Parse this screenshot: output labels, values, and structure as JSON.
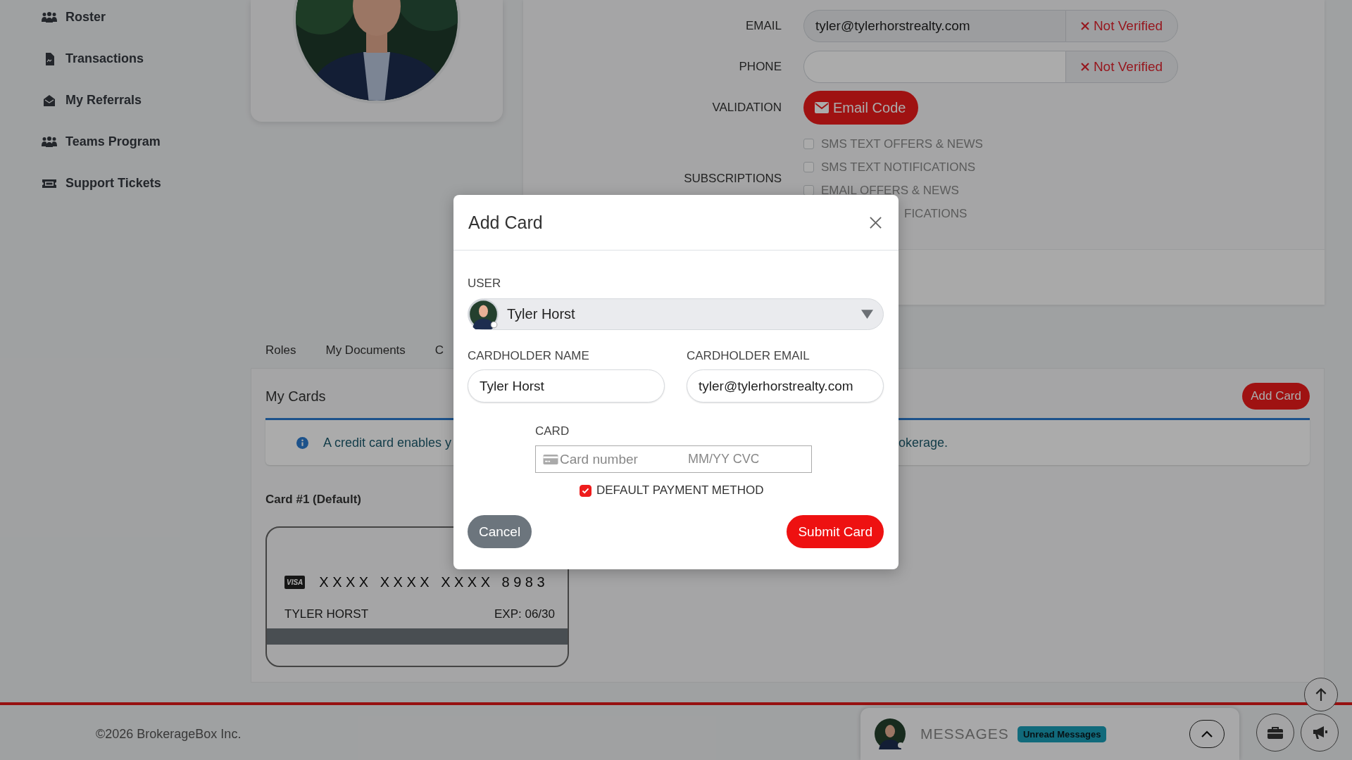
{
  "sidebar": {
    "items": [
      {
        "label": "Roster"
      },
      {
        "label": "Transactions"
      },
      {
        "label": "My Referrals"
      },
      {
        "label": "Teams Program"
      },
      {
        "label": "Support Tickets"
      }
    ]
  },
  "contact": {
    "rows": [
      {
        "label": "EMAIL",
        "value": "tyler@tylerhorstrealty.com",
        "status": "Not Verified",
        "readonly": true
      },
      {
        "label": "PHONE",
        "status": "Not Verified",
        "readonly": false
      }
    ]
  },
  "validation": {
    "label": "VALIDATION",
    "button": "Email Code"
  },
  "subscriptions": {
    "label": "SUBSCRIPTIONS",
    "options": [
      {
        "label": "SMS TEXT OFFERS & NEWS",
        "checked": false
      },
      {
        "label": "SMS TEXT NOTIFICATIONS",
        "checked": false
      },
      {
        "label": "EMAIL OFFERS & NEWS",
        "checked": false
      }
    ],
    "partial_option": "FICATIONS"
  },
  "tabs": [
    {
      "label": "Roles",
      "selected": false
    },
    {
      "label": "My Documents",
      "selected": false
    },
    {
      "label": "C",
      "selected": false
    }
  ],
  "cards_panel": {
    "title": "My Cards",
    "add_button": "Add Card",
    "info_start": "A credit card enables y",
    "info_end": "okerage.",
    "cards": [
      {
        "title": "Card #1 (Default)",
        "brand": "VISA",
        "number": "XXXX XXXX XXXX 8983",
        "name": "TYLER HORST",
        "expiry": "EXP: 06/30"
      }
    ]
  },
  "footer": {
    "copyright": "©2026 BrokerageBox Inc."
  },
  "messages": {
    "title": "MESSAGES",
    "badge": "Unread Messages"
  },
  "modal": {
    "title": "Add Card",
    "user_label": "USER",
    "user": "Tyler Horst",
    "name_label": "CARDHOLDER NAME",
    "name": "Tyler Horst",
    "email_label": "CARDHOLDER EMAIL",
    "email": "tyler@tylerhorstrealty.com",
    "card_label": "CARD",
    "card_placeholder": "Card number",
    "expiry_placeholder": "MM/YY CVC",
    "default": {
      "label": "DEFAULT PAYMENT METHOD",
      "checked": true
    },
    "cancel": "Cancel",
    "submit": "Submit Card"
  }
}
